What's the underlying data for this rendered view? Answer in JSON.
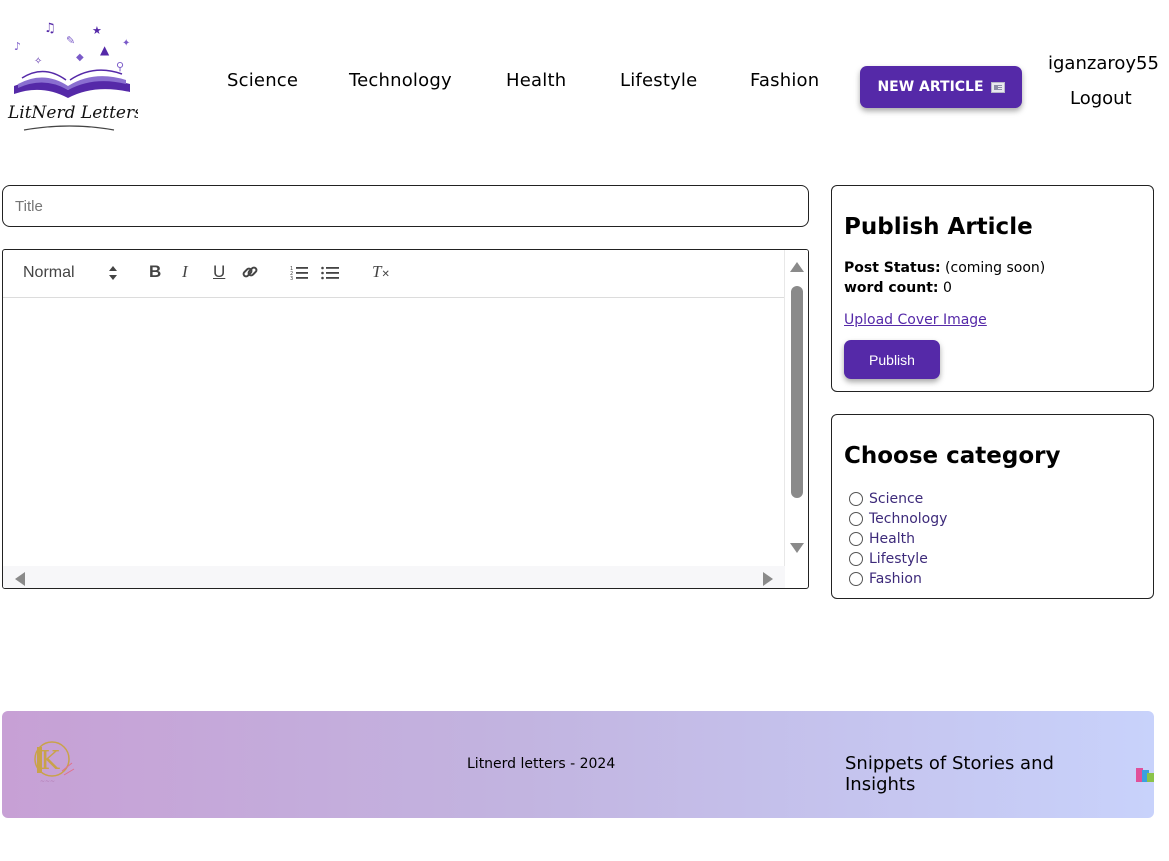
{
  "header": {
    "nav": [
      "Science",
      "Technology",
      "Health",
      "Lifestyle",
      "Fashion"
    ],
    "new_article_label": "NEW ARTICLE",
    "username": "iganzaroy55",
    "logout_label": "Logout"
  },
  "editor": {
    "title_placeholder": "Title",
    "format_select": "Normal"
  },
  "publish": {
    "heading": "Publish Article",
    "status_label": "Post Status:",
    "status_value": "(coming soon)",
    "word_count_label": "word count:",
    "word_count_value": "0",
    "upload_label": "Upload Cover Image",
    "publish_label": "Publish"
  },
  "category": {
    "heading": "Choose category",
    "options": [
      "Science",
      "Technology",
      "Health",
      "Lifestyle",
      "Fashion"
    ]
  },
  "footer": {
    "copyright": "Litnerd letters - 2024",
    "tagline": "Snippets of Stories and Insights"
  },
  "colors": {
    "accent": "#5529a8",
    "category_text": "#3d2a7a"
  }
}
